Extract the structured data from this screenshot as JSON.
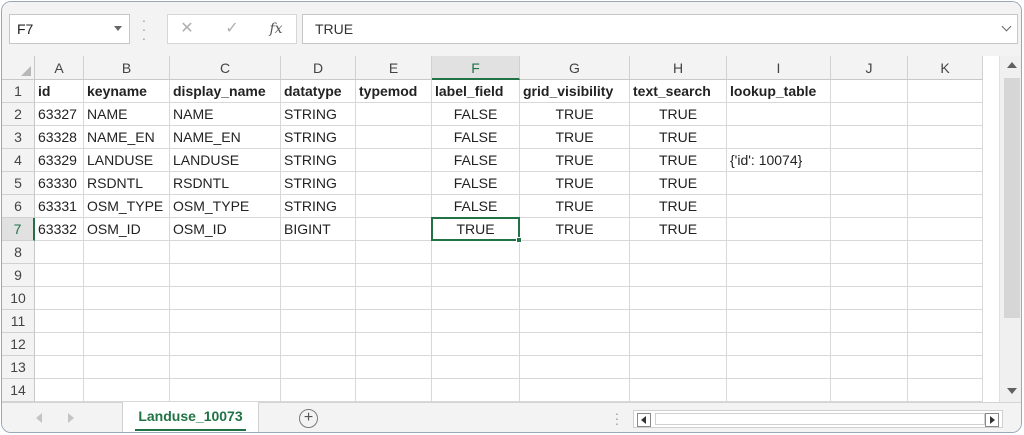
{
  "formula_bar": {
    "name_box": "F7",
    "cancel_icon": "close-icon",
    "enter_icon": "check-icon",
    "fx_label": "fx",
    "formula_value": "TRUE"
  },
  "columns": [
    "A",
    "B",
    "C",
    "D",
    "E",
    "F",
    "G",
    "H",
    "I",
    "J",
    "K"
  ],
  "rows": [
    "1",
    "2",
    "3",
    "4",
    "5",
    "6",
    "7",
    "8",
    "9",
    "10",
    "11",
    "12",
    "13",
    "14"
  ],
  "selected_cell": "F7",
  "table": [
    [
      "id",
      "keyname",
      "display_name",
      "datatype",
      "typemod",
      "label_field",
      "grid_visibility",
      "text_search",
      "lookup_table",
      "",
      ""
    ],
    [
      "63327",
      "NAME",
      "NAME",
      "STRING",
      "",
      "FALSE",
      "TRUE",
      "TRUE",
      "",
      "",
      ""
    ],
    [
      "63328",
      "NAME_EN",
      "NAME_EN",
      "STRING",
      "",
      "FALSE",
      "TRUE",
      "TRUE",
      "",
      "",
      ""
    ],
    [
      "63329",
      "LANDUSE",
      "LANDUSE",
      "STRING",
      "",
      "FALSE",
      "TRUE",
      "TRUE",
      "{'id': 10074}",
      "",
      ""
    ],
    [
      "63330",
      "RSDNTL",
      "RSDNTL",
      "STRING",
      "",
      "FALSE",
      "TRUE",
      "TRUE",
      "",
      "",
      ""
    ],
    [
      "63331",
      "OSM_TYPE",
      "OSM_TYPE",
      "STRING",
      "",
      "FALSE",
      "TRUE",
      "TRUE",
      "",
      "",
      ""
    ],
    [
      "63332",
      "OSM_ID",
      "OSM_ID",
      "BIGINT",
      "",
      "TRUE",
      "TRUE",
      "TRUE",
      "",
      "",
      ""
    ]
  ],
  "sheet_tabs": {
    "active": "Landuse_10073",
    "add_icon": "plus-circle-icon"
  },
  "colors": {
    "accent": "#217346",
    "header_bg": "#f3f3f3",
    "gridline": "#d8d8d8"
  }
}
